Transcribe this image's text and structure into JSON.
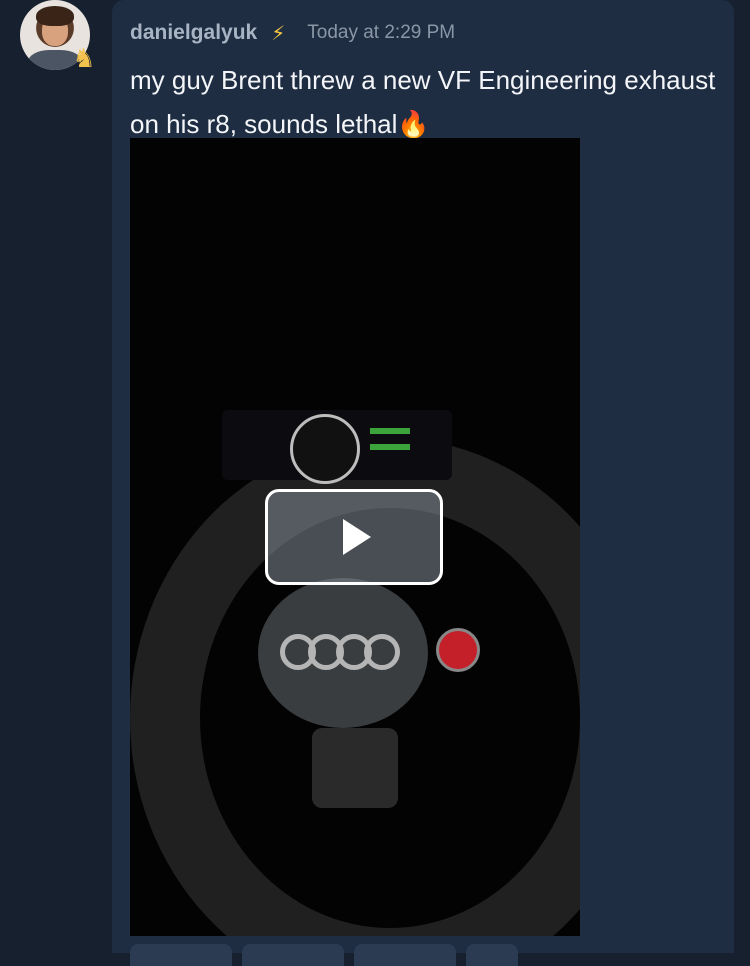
{
  "message": {
    "username": "danielgalyuk",
    "bolt_icon": "⚡",
    "timestamp": "Today at 2:29 PM",
    "text": "my guy Brent threw a new VF Engineering exhaust on his r8, sounds lethal",
    "emoji": "🔥",
    "badge_icon": "♞"
  },
  "colors": {
    "background": "#16202f",
    "message_bg": "#1e2d42",
    "username": "#a8b4c4",
    "accent_bolt": "#f5c542"
  }
}
